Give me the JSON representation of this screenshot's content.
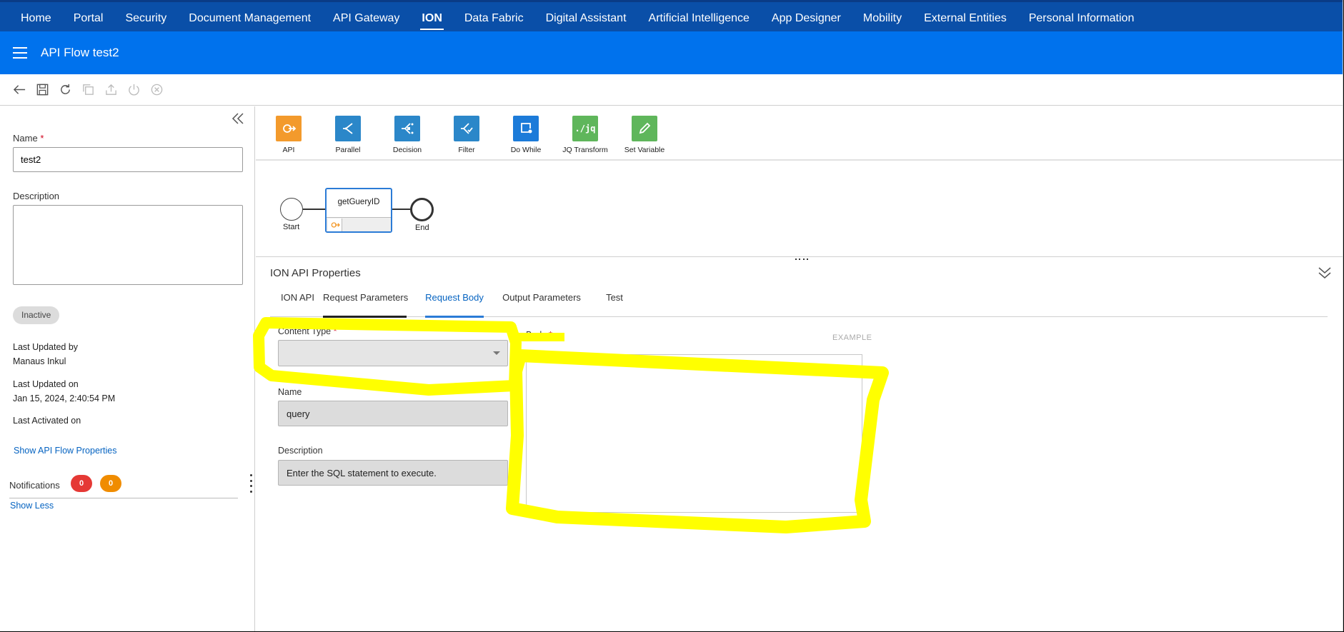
{
  "topnav": {
    "items": [
      "Home",
      "Portal",
      "Security",
      "Document Management",
      "API Gateway",
      "ION",
      "Data Fabric",
      "Digital Assistant",
      "Artificial Intelligence",
      "App Designer",
      "Mobility",
      "External Entities",
      "Personal Information"
    ],
    "active": "ION"
  },
  "header": {
    "title": "API Flow test2"
  },
  "toolbar": {
    "icons": [
      "back-arrow-icon",
      "save-icon",
      "refresh-icon",
      "copy-icon",
      "export-icon",
      "power-icon",
      "close-circle-icon"
    ]
  },
  "left": {
    "name_label": "Name",
    "required_mark": "*",
    "name_value": "test2",
    "description_label": "Description",
    "description_value": "",
    "status": "Inactive",
    "last_updated_by_label": "Last Updated by",
    "last_updated_by_value": "Manaus Inkul",
    "last_updated_on_label": "Last Updated on",
    "last_updated_on_value": "Jan 15, 2024, 2:40:54 PM",
    "last_activated_label": "Last Activated on",
    "show_props_link": "Show API Flow Properties",
    "notifications_label": "Notifications",
    "notif_red_count": "0",
    "notif_orange_count": "0",
    "show_less_link": "Show Less"
  },
  "palette": {
    "items": [
      {
        "label": "API",
        "color": "#f39a2c",
        "icon": "api-icon"
      },
      {
        "label": "Parallel",
        "color": "#2b87c9",
        "icon": "parallel-icon"
      },
      {
        "label": "Decision",
        "color": "#2b87c9",
        "icon": "decision-icon"
      },
      {
        "label": "Filter",
        "color": "#2b87c9",
        "icon": "filter-icon"
      },
      {
        "label": "Do While",
        "color": "#1c7bd9",
        "icon": "do-while-icon"
      },
      {
        "label": "JQ Transform",
        "color": "#5fb65b",
        "icon_text": "./jq"
      },
      {
        "label": "Set Variable",
        "color": "#5fb65b",
        "icon": "pencil-icon"
      }
    ]
  },
  "flow": {
    "start_label": "Start",
    "end_label": "End",
    "task_name": "getGueryID"
  },
  "properties": {
    "title": "ION API Properties",
    "tabs": [
      "ION API",
      "Request Parameters",
      "Request Body",
      "Output Parameters",
      "Test"
    ],
    "active_tab": "Request Body",
    "content_type_label": "Content Type",
    "content_type_value": "",
    "body_label": "Body",
    "example_link": "EXAMPLE",
    "param_name_label": "Name",
    "param_name_value": "query",
    "param_desc_label": "Description",
    "param_desc_value": "Enter the SQL statement to execute."
  },
  "colors": {
    "topnav_bg": "#0a4fa8",
    "header_bg": "#0072ed",
    "link": "#0563c1",
    "highlight": "#ffff00",
    "badge_red": "#e53935",
    "badge_orange": "#f08c00"
  }
}
